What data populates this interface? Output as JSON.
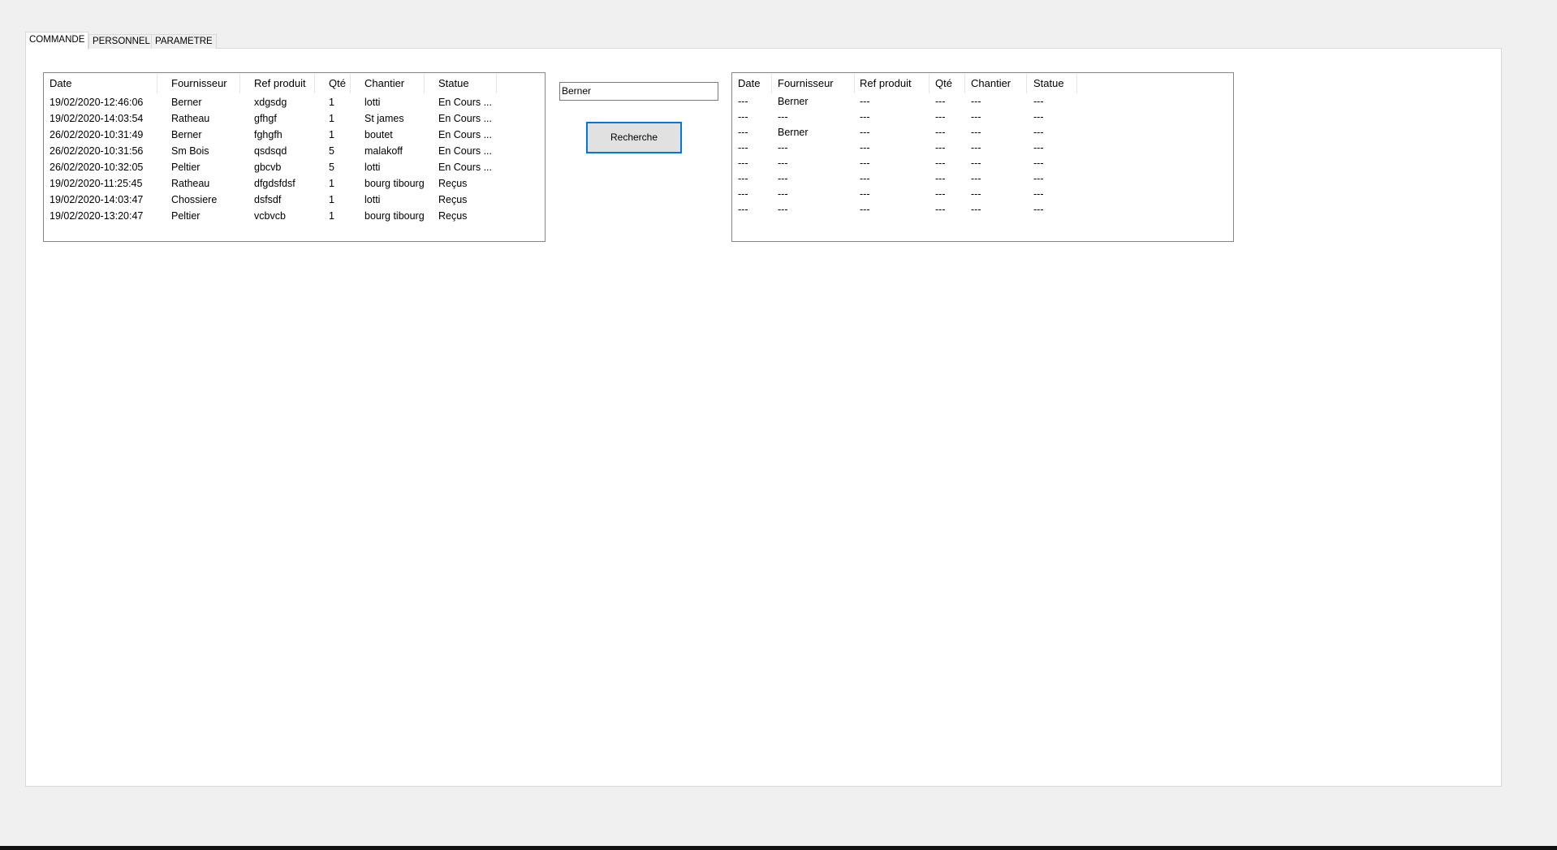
{
  "tabs": [
    {
      "label": "COMMANDE"
    },
    {
      "label": "PERSONNEL"
    },
    {
      "label": "PARAMETRE"
    }
  ],
  "orders_table": {
    "columns": [
      "Date",
      "Fournisseur",
      "Ref produit",
      "Qté",
      "Chantier",
      "Statue"
    ],
    "rows": [
      [
        "19/02/2020-12:46:06",
        "Berner",
        "xdgsdg",
        "1",
        "lotti",
        "En Cours ..."
      ],
      [
        "19/02/2020-14:03:54",
        "Ratheau",
        "gfhgf",
        "1",
        "St james",
        "En Cours ..."
      ],
      [
        "26/02/2020-10:31:49",
        "Berner",
        "fghgfh",
        "1",
        "boutet",
        "En Cours ..."
      ],
      [
        "26/02/2020-10:31:56",
        "Sm Bois",
        "qsdsqd",
        "5",
        "malakoff",
        "En Cours ..."
      ],
      [
        "26/02/2020-10:32:05",
        "Peltier",
        "gbcvb",
        "5",
        "lotti",
        "En Cours ..."
      ],
      [
        "19/02/2020-11:25:45",
        "Ratheau",
        "dfgdsfdsf",
        "1",
        "bourg tibourg",
        "Reçus"
      ],
      [
        "19/02/2020-14:03:47",
        "Chossiere",
        "dsfsdf",
        "1",
        "lotti",
        "Reçus"
      ],
      [
        "19/02/2020-13:20:47",
        "Peltier",
        "vcbvcb",
        "1",
        "bourg tibourg",
        "Reçus"
      ]
    ]
  },
  "search": {
    "value": "Berner",
    "button_label": "Recherche"
  },
  "results_table": {
    "columns": [
      "Date",
      "Fournisseur",
      "Ref produit",
      "Qté",
      "Chantier",
      "Statue"
    ],
    "rows": [
      [
        "---",
        "Berner",
        "---",
        "---",
        "---",
        "---"
      ],
      [
        "---",
        "---",
        "---",
        "---",
        "---",
        "---"
      ],
      [
        "---",
        "Berner",
        "---",
        "---",
        "---",
        "---"
      ],
      [
        "---",
        "---",
        "---",
        "---",
        "---",
        "---"
      ],
      [
        "---",
        "---",
        "---",
        "---",
        "---",
        "---"
      ],
      [
        "---",
        "---",
        "---",
        "---",
        "---",
        "---"
      ],
      [
        "---",
        "---",
        "---",
        "---",
        "---",
        "---"
      ],
      [
        "---",
        "---",
        "---",
        "---",
        "---",
        "---"
      ]
    ]
  }
}
